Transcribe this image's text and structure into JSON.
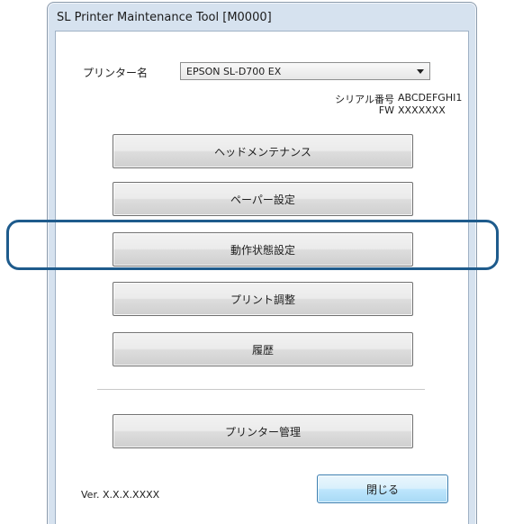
{
  "window": {
    "title": "SL Printer Maintenance Tool [M0000]"
  },
  "printer": {
    "label": "プリンター名",
    "selected": "EPSON SL-D700 EX"
  },
  "info": {
    "serial_label": "シリアル番号",
    "serial_value": "ABCDEFGHI1",
    "fw_label": "FW",
    "fw_value": "XXXXXXX"
  },
  "buttons": [
    {
      "label": "ヘッドメンテナンス"
    },
    {
      "label": "ペーパー設定"
    },
    {
      "label": "動作状態設定",
      "highlighted": true
    },
    {
      "label": "プリント調整"
    },
    {
      "label": "履歴"
    },
    {
      "label": "プリンター管理"
    }
  ],
  "footer": {
    "version": "Ver. X.X.X.XXXX",
    "close_label": "閉じる"
  },
  "colors": {
    "highlight_border": "#1e5b8c",
    "window_frame": "#d6e2ef",
    "close_button_border": "#3c7fb1"
  }
}
